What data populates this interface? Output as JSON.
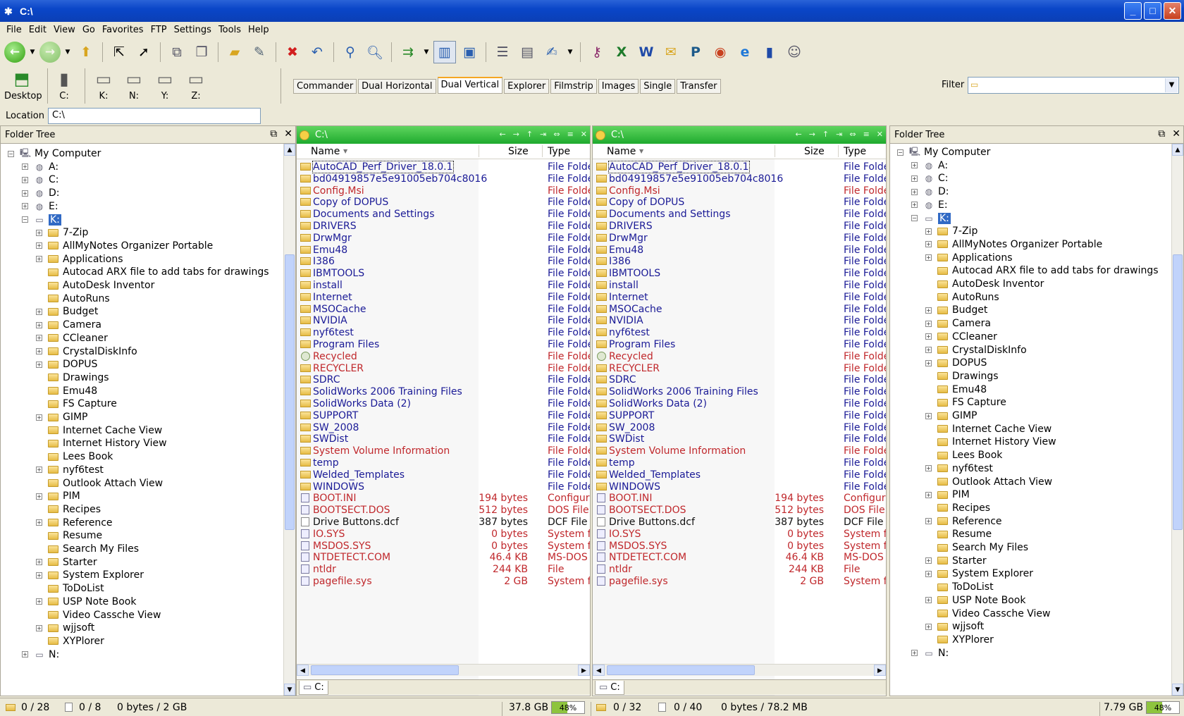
{
  "window": {
    "title": "C:\\",
    "min": "_",
    "max": "□",
    "close": "✕"
  },
  "menu": [
    "File",
    "Edit",
    "View",
    "Go",
    "Favorites",
    "FTP",
    "Settings",
    "Tools",
    "Help"
  ],
  "drives": [
    {
      "label": "Desktop",
      "icon": "desktop-icon"
    },
    {
      "label": "C:",
      "icon": "hard-drive-icon"
    },
    {
      "label": "K:",
      "icon": "network-drive-icon"
    },
    {
      "label": "N:",
      "icon": "network-drive-icon"
    },
    {
      "label": "Y:",
      "icon": "network-drive-icon"
    },
    {
      "label": "Z:",
      "icon": "network-drive-icon"
    }
  ],
  "layout_tabs": [
    "Commander",
    "Dual Horizontal",
    "Dual Vertical",
    "Explorer",
    "Filmstrip",
    "Images",
    "Single",
    "Transfer"
  ],
  "layout_active": "Dual Vertical",
  "filter": {
    "label": "Filter",
    "value": ""
  },
  "location": {
    "label": "Location",
    "value": "C:\\"
  },
  "tree": {
    "title": "Folder Tree",
    "root": "My Computer",
    "drives": [
      "A:",
      "C:",
      "D:",
      "E:"
    ],
    "selected_drive": "K:",
    "folders": [
      {
        "name": "7-Zip",
        "exp": true
      },
      {
        "name": "AllMyNotes Organizer Portable",
        "exp": true
      },
      {
        "name": "Applications",
        "exp": true
      },
      {
        "name": "Autocad ARX file to add tabs for drawings",
        "exp": false
      },
      {
        "name": "AutoDesk Inventor",
        "exp": false
      },
      {
        "name": "AutoRuns",
        "exp": false
      },
      {
        "name": "Budget",
        "exp": true
      },
      {
        "name": "Camera",
        "exp": true
      },
      {
        "name": "CCleaner",
        "exp": true
      },
      {
        "name": "CrystalDiskInfo",
        "exp": true
      },
      {
        "name": "DOPUS",
        "exp": true
      },
      {
        "name": "Drawings",
        "exp": false
      },
      {
        "name": "Emu48",
        "exp": false
      },
      {
        "name": "FS Capture",
        "exp": false
      },
      {
        "name": "GIMP",
        "exp": true
      },
      {
        "name": "Internet Cache View",
        "exp": false
      },
      {
        "name": "Internet History View",
        "exp": false
      },
      {
        "name": "Lees Book",
        "exp": false
      },
      {
        "name": "nyf6test",
        "exp": true
      },
      {
        "name": "Outlook Attach View",
        "exp": false
      },
      {
        "name": "PIM",
        "exp": true
      },
      {
        "name": "Recipes",
        "exp": false
      },
      {
        "name": "Reference",
        "exp": true
      },
      {
        "name": "Resume",
        "exp": false
      },
      {
        "name": "Search My Files",
        "exp": false
      },
      {
        "name": "Starter",
        "exp": true
      },
      {
        "name": "System Explorer",
        "exp": true
      },
      {
        "name": "ToDoList",
        "exp": false
      },
      {
        "name": "USP Note Book",
        "exp": true
      },
      {
        "name": "Video Cassche View",
        "exp": false
      },
      {
        "name": "wjjsoft",
        "exp": true
      },
      {
        "name": "XYPlorer",
        "exp": false
      }
    ],
    "last_drive": "N:"
  },
  "file_pane": {
    "path": "C:\\",
    "columns": {
      "name": "Name",
      "size": "Size",
      "type": "Type"
    },
    "tab": "C:",
    "files": [
      {
        "name": "AutoCAD_Perf_Driver_18.0.1",
        "size": "",
        "type": "File Folde",
        "color": "blue",
        "icon": "folder"
      },
      {
        "name": "bd04919857e5e91005eb704c8016",
        "size": "",
        "type": "File Folde",
        "color": "blue",
        "icon": "folder"
      },
      {
        "name": "Config.Msi",
        "size": "",
        "type": "File Folde",
        "color": "red",
        "icon": "folder"
      },
      {
        "name": "Copy of DOPUS",
        "size": "",
        "type": "File Folde",
        "color": "blue",
        "icon": "folder"
      },
      {
        "name": "Documents and Settings",
        "size": "",
        "type": "File Folde",
        "color": "blue",
        "icon": "folder"
      },
      {
        "name": "DRIVERS",
        "size": "",
        "type": "File Folde",
        "color": "blue",
        "icon": "folder"
      },
      {
        "name": "DrwMgr",
        "size": "",
        "type": "File Folde",
        "color": "blue",
        "icon": "folder"
      },
      {
        "name": "Emu48",
        "size": "",
        "type": "File Folde",
        "color": "blue",
        "icon": "folder"
      },
      {
        "name": "I386",
        "size": "",
        "type": "File Folde",
        "color": "blue",
        "icon": "folder"
      },
      {
        "name": "IBMTOOLS",
        "size": "",
        "type": "File Folde",
        "color": "blue",
        "icon": "folder"
      },
      {
        "name": "install",
        "size": "",
        "type": "File Folde",
        "color": "blue",
        "icon": "folder"
      },
      {
        "name": "Internet",
        "size": "",
        "type": "File Folde",
        "color": "blue",
        "icon": "folder"
      },
      {
        "name": "MSOCache",
        "size": "",
        "type": "File Folde",
        "color": "blue",
        "icon": "folder"
      },
      {
        "name": "NVIDIA",
        "size": "",
        "type": "File Folde",
        "color": "blue",
        "icon": "folder"
      },
      {
        "name": "nyf6test",
        "size": "",
        "type": "File Folde",
        "color": "blue",
        "icon": "folder"
      },
      {
        "name": "Program Files",
        "size": "",
        "type": "File Folde",
        "color": "blue",
        "icon": "folder"
      },
      {
        "name": "Recycled",
        "size": "",
        "type": "File Folde",
        "color": "red",
        "icon": "recycle"
      },
      {
        "name": "RECYCLER",
        "size": "",
        "type": "File Folde",
        "color": "red",
        "icon": "folder"
      },
      {
        "name": "SDRC",
        "size": "",
        "type": "File Folde",
        "color": "blue",
        "icon": "folder"
      },
      {
        "name": "SolidWorks 2006 Training Files",
        "size": "",
        "type": "File Folde",
        "color": "blue",
        "icon": "folder"
      },
      {
        "name": "SolidWorks Data (2)",
        "size": "",
        "type": "File Folde",
        "color": "blue",
        "icon": "folder"
      },
      {
        "name": "SUPPORT",
        "size": "",
        "type": "File Folde",
        "color": "blue",
        "icon": "folder"
      },
      {
        "name": "SW_2008",
        "size": "",
        "type": "File Folde",
        "color": "blue",
        "icon": "folder"
      },
      {
        "name": "SWDist",
        "size": "",
        "type": "File Folde",
        "color": "blue",
        "icon": "folder"
      },
      {
        "name": "System Volume Information",
        "size": "",
        "type": "File Folde",
        "color": "red",
        "icon": "folder"
      },
      {
        "name": "temp",
        "size": "",
        "type": "File Folde",
        "color": "blue",
        "icon": "folder"
      },
      {
        "name": "Welded_Templates",
        "size": "",
        "type": "File Folde",
        "color": "blue",
        "icon": "folder"
      },
      {
        "name": "WINDOWS",
        "size": "",
        "type": "File Folde",
        "color": "blue",
        "icon": "folder"
      },
      {
        "name": "BOOT.INI",
        "size": "194 bytes",
        "type": "Configura",
        "color": "red",
        "icon": "sysfile"
      },
      {
        "name": "BOOTSECT.DOS",
        "size": "512 bytes",
        "type": "DOS File",
        "color": "red",
        "icon": "sysfile"
      },
      {
        "name": "Drive Buttons.dcf",
        "size": "387 bytes",
        "type": "DCF File",
        "color": "black",
        "icon": "file"
      },
      {
        "name": "IO.SYS",
        "size": "0 bytes",
        "type": "System f",
        "color": "red",
        "icon": "sysfile"
      },
      {
        "name": "MSDOS.SYS",
        "size": "0 bytes",
        "type": "System f",
        "color": "red",
        "icon": "sysfile"
      },
      {
        "name": "NTDETECT.COM",
        "size": "46.4 KB",
        "type": "MS-DOS",
        "color": "red",
        "icon": "sysfile"
      },
      {
        "name": "ntldr",
        "size": "244 KB",
        "type": "File",
        "color": "red",
        "icon": "sysfile"
      },
      {
        "name": "pagefile.sys",
        "size": "2 GB",
        "type": "System f",
        "color": "red",
        "icon": "sysfile"
      }
    ]
  },
  "status": {
    "left_folders": "0 / 28",
    "left_files": "0 / 8",
    "left_bytes": "0 bytes / 2 GB",
    "left_free": "37.8 GB",
    "left_pct": "48%",
    "left_fill": 0.48,
    "right_folders": "0 / 32",
    "right_files": "0 / 40",
    "right_bytes": "0 bytes / 78.2 MB",
    "right_free": "7.79 GB",
    "right_pct": "48%",
    "right_fill": 0.48
  },
  "colors": {
    "pane_header": "#1eaa2e",
    "blue_text": "#1a1a96",
    "red_text": "#c0282c",
    "title_bar": "#0a46c8"
  }
}
